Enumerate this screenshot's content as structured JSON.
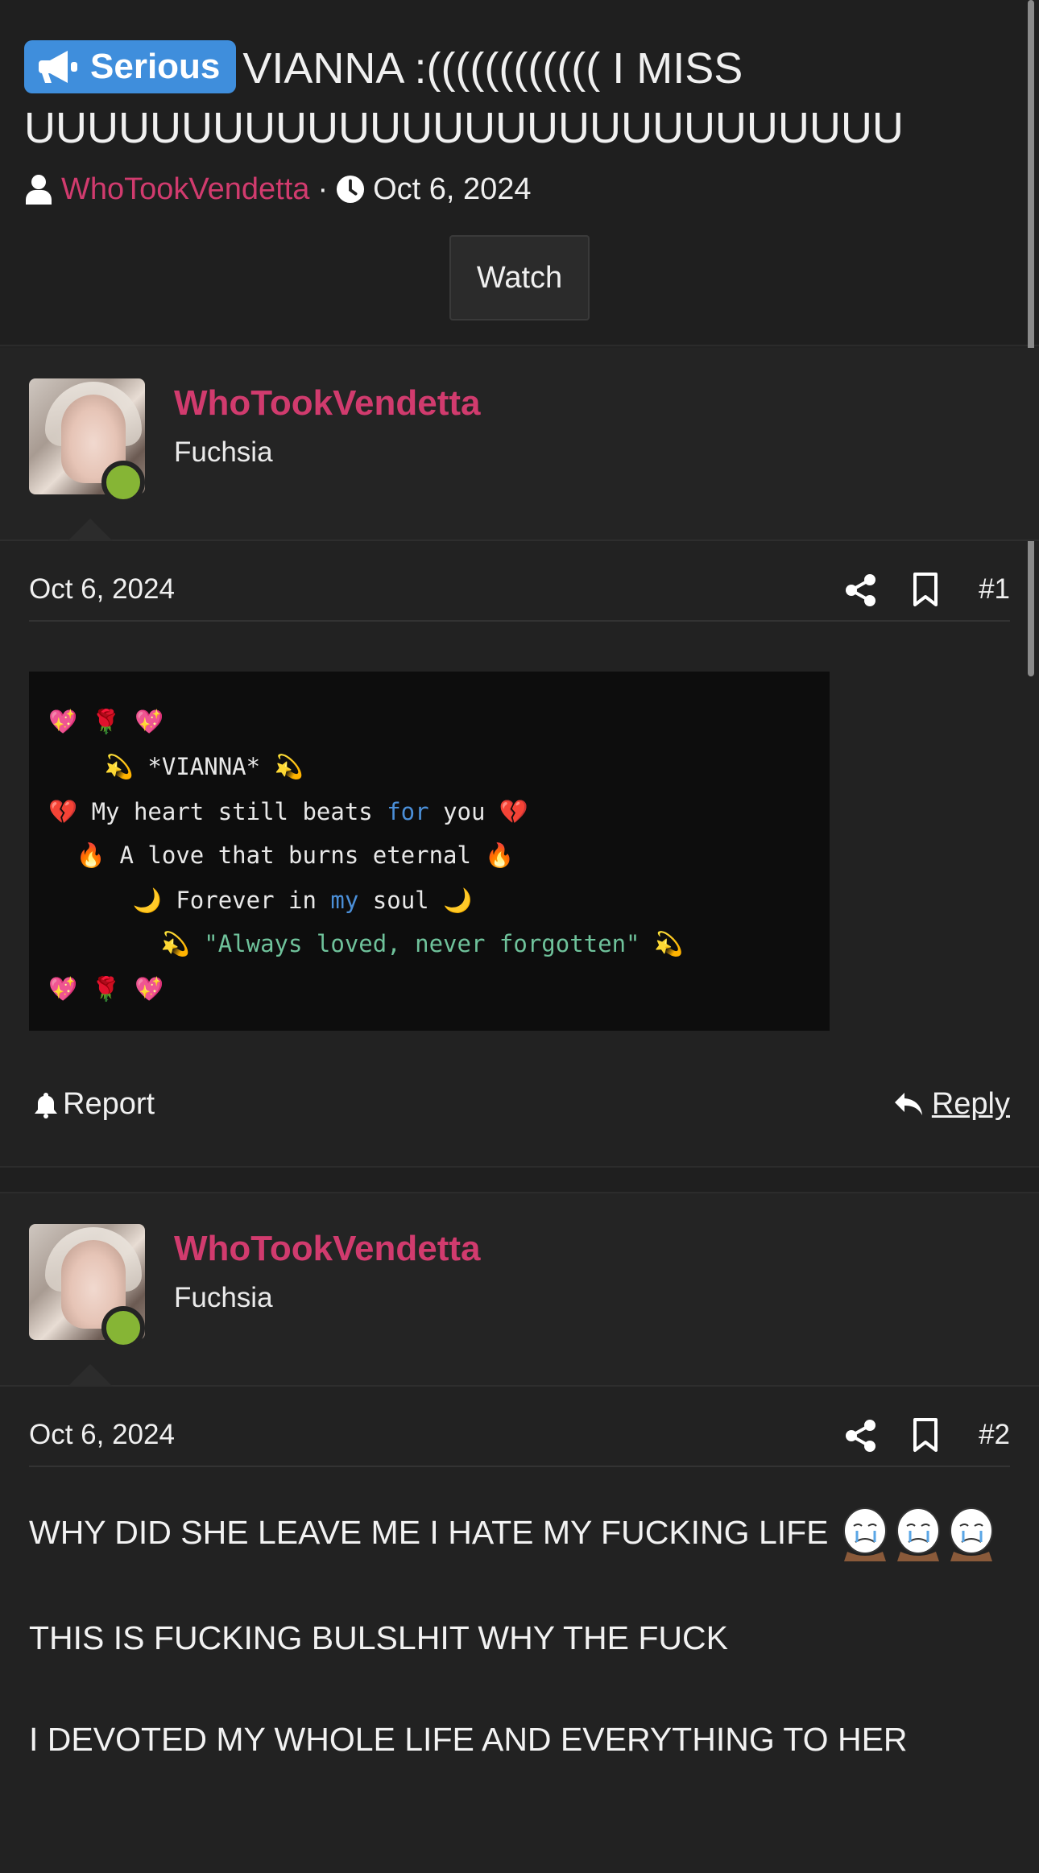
{
  "thread": {
    "prefix": "Serious",
    "title": "VIANNA :(((((((((((( I MISS UUUUUUUUUUUUUUUUUUUUUUUUUUUU",
    "author": "WhoTookVendetta",
    "date": "Oct 6, 2024",
    "watch_label": "Watch"
  },
  "posts": [
    {
      "username": "WhoTookVendetta",
      "user_title": "Fuchsia",
      "date": "Oct 6, 2024",
      "number": "#1",
      "code_lines": [
        {
          "parts": [
            {
              "t": "💖 🌹 💖",
              "c": ""
            }
          ]
        },
        {
          "parts": [
            {
              "t": "    💫 *VIANNA* 💫",
              "c": ""
            }
          ]
        },
        {
          "parts": [
            {
              "t": "💔 My heart still beats ",
              "c": ""
            },
            {
              "t": "for",
              "c": "kw"
            },
            {
              "t": " you 💔",
              "c": ""
            }
          ]
        },
        {
          "parts": [
            {
              "t": "  🔥 A love that burns eternal 🔥",
              "c": ""
            }
          ]
        },
        {
          "parts": [
            {
              "t": "      🌙 Forever in ",
              "c": ""
            },
            {
              "t": "my",
              "c": "kw"
            },
            {
              "t": " soul 🌙",
              "c": ""
            }
          ]
        },
        {
          "parts": [
            {
              "t": "        💫 ",
              "c": ""
            },
            {
              "t": "\"Always loved, never forgotten\"",
              "c": "str"
            },
            {
              "t": " 💫",
              "c": ""
            }
          ]
        },
        {
          "parts": [
            {
              "t": "💖 🌹 💖",
              "c": ""
            }
          ]
        }
      ],
      "report_label": "Report",
      "reply_label": "Reply"
    },
    {
      "username": "WhoTookVendetta",
      "user_title": "Fuchsia",
      "date": "Oct 6, 2024",
      "number": "#2",
      "body": [
        "WHY DID SHE LEAVE ME I HATE MY FUCKING LIFE",
        "THIS IS FUCKING BULSLHIT WHY THE FUCK",
        "I DEVOTED MY WHOLE LIFE AND EVERYTHING TO HER"
      ]
    }
  ],
  "colors": {
    "accent_pink": "#d13b6e",
    "badge_blue": "#3f8edc",
    "online_green": "#86b535"
  },
  "icons": [
    "megaphone-icon",
    "user-icon",
    "clock-icon",
    "share-icon",
    "bookmark-icon",
    "bell-icon",
    "reply-icon",
    "crying-face-icon"
  ]
}
